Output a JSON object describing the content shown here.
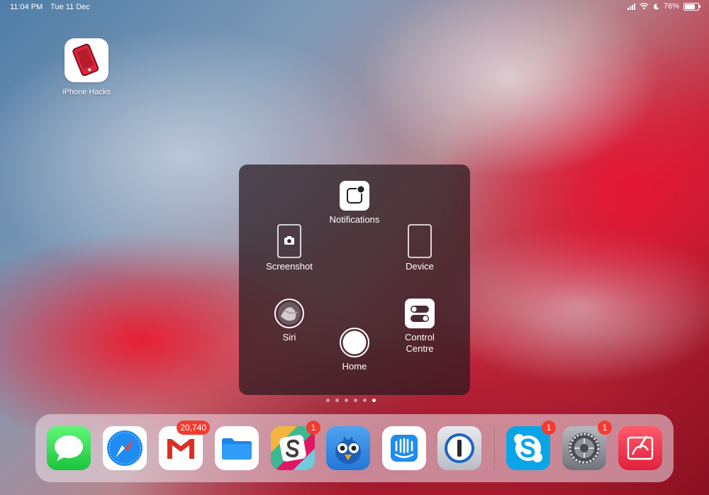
{
  "status_bar": {
    "time": "11:04 PM",
    "date": "Tue 11 Dec",
    "battery": "76%"
  },
  "home_app": {
    "label": "iPhone Hacks"
  },
  "assistive_touch": {
    "notifications": "Notifications",
    "screenshot": "Screenshot",
    "device": "Device",
    "siri": "Siri",
    "home": "Home",
    "control_centre_line1": "Control",
    "control_centre_line2": "Centre"
  },
  "page_dots": {
    "count": 6,
    "active_index": 5
  },
  "dock": {
    "gmail_badge": "20,740",
    "slack_badge": "1",
    "skype_badge": "1",
    "settings_badge": "1"
  },
  "colors": {
    "badge": "#f43b30",
    "menu_bg": "#28191e",
    "accent_red": "#d11f33"
  }
}
